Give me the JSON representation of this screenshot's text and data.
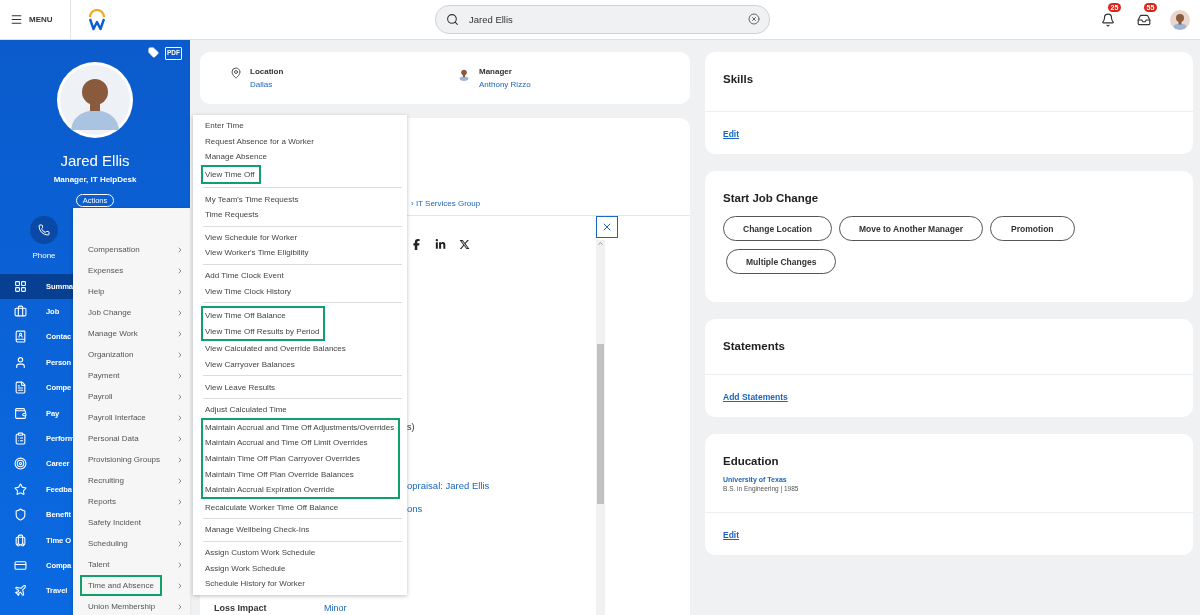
{
  "header": {
    "menu_label": "MENU",
    "search": {
      "value": "Jared Ellis"
    },
    "notifications_badge": "25",
    "inbox_badge": "55"
  },
  "profile": {
    "pdf_label": "PDF",
    "name": "Jared Ellis",
    "title": "Manager, IT HelpDesk",
    "actions_label": "Actions",
    "contact": [
      {
        "label": "Phone"
      }
    ]
  },
  "nav": [
    {
      "label": "Summa",
      "selected": true
    },
    {
      "label": "Job",
      "selected": false
    },
    {
      "label": "Contac",
      "selected": false
    },
    {
      "label": "Person",
      "selected": false
    },
    {
      "label": "Compe",
      "selected": false
    },
    {
      "label": "Pay",
      "selected": false
    },
    {
      "label": "Perform",
      "selected": false
    },
    {
      "label": "Career",
      "selected": false
    },
    {
      "label": "Feedba",
      "selected": false
    },
    {
      "label": "Benefit",
      "selected": false
    },
    {
      "label": "Time O",
      "selected": false
    },
    {
      "label": "Compa",
      "selected": false
    },
    {
      "label": "Travel",
      "selected": false
    }
  ],
  "info_card": {
    "fields": [
      {
        "kind": "location",
        "label": "Location",
        "value": "Dallas"
      },
      {
        "kind": "person",
        "label": "Manager",
        "value": "Anthony Rizzo"
      }
    ]
  },
  "detail_card": {
    "breadcrumb": "› IT Services Group",
    "fragments": [
      {
        "kind": "text",
        "text": "s)"
      },
      {
        "kind": "link",
        "text": "opraisal: Jared Ellis"
      },
      {
        "kind": "link",
        "text": "ons"
      }
    ],
    "rows": [
      {
        "label": "Loss Impact",
        "value": "Minor"
      }
    ]
  },
  "actions_menu": {
    "items": [
      {
        "label": "Compensation",
        "highlighted": false
      },
      {
        "label": "Expenses",
        "highlighted": false
      },
      {
        "label": "Help",
        "highlighted": false
      },
      {
        "label": "Job Change",
        "highlighted": false
      },
      {
        "label": "Manage Work",
        "highlighted": false
      },
      {
        "label": "Organization",
        "highlighted": false
      },
      {
        "label": "Payment",
        "highlighted": false
      },
      {
        "label": "Payroll",
        "highlighted": false
      },
      {
        "label": "Payroll Interface",
        "highlighted": false
      },
      {
        "label": "Personal Data",
        "highlighted": false
      },
      {
        "label": "Provisioning Groups",
        "highlighted": false
      },
      {
        "label": "Recruiting",
        "highlighted": false
      },
      {
        "label": "Reports",
        "highlighted": false
      },
      {
        "label": "Safety Incident",
        "highlighted": false
      },
      {
        "label": "Scheduling",
        "highlighted": false
      },
      {
        "label": "Talent",
        "highlighted": false
      },
      {
        "label": "Time and Absence",
        "highlighted": true
      },
      {
        "label": "Union Membership",
        "highlighted": false
      }
    ]
  },
  "submenu": {
    "groups": [
      {
        "items": [
          {
            "label": "Enter Time",
            "highlighted": false
          },
          {
            "label": "Request Absence for a Worker",
            "highlighted": false
          },
          {
            "label": "Manage Absence",
            "highlighted": false
          },
          {
            "label": "View Time Off",
            "highlighted": true
          }
        ]
      },
      {
        "items": [
          {
            "label": "My Team's Time Requests",
            "highlighted": false
          },
          {
            "label": "Time Requests",
            "highlighted": false
          }
        ]
      },
      {
        "items": [
          {
            "label": "View Schedule for Worker",
            "highlighted": false
          },
          {
            "label": "View Worker's Time Eligibility",
            "highlighted": false
          }
        ]
      },
      {
        "items": [
          {
            "label": "Add Time Clock Event",
            "highlighted": false
          },
          {
            "label": "View Time Clock History",
            "highlighted": false
          }
        ]
      },
      {
        "items": [
          {
            "label": "View Time Off Balance",
            "highlighted": true
          },
          {
            "label": "View Time Off Results by Period",
            "highlighted": true
          },
          {
            "label": "View Calculated and Override Balances",
            "highlighted": false
          },
          {
            "label": "View Carryover Balances",
            "highlighted": false
          }
        ]
      },
      {
        "items": [
          {
            "label": "View Leave Results",
            "highlighted": false
          }
        ]
      },
      {
        "items": [
          {
            "label": "Adjust Calculated Time",
            "highlighted": false
          },
          {
            "label": "Maintain Accrual and Time Off Adjustments/Overrides",
            "highlighted": true
          },
          {
            "label": "Maintain Accrual and Time Off Limit Overrides",
            "highlighted": true
          },
          {
            "label": "Maintain Time Off Plan Carryover Overrides",
            "highlighted": true
          },
          {
            "label": "Maintain Time Off Plan Override Balances",
            "highlighted": true
          },
          {
            "label": "Maintain Accrual Expiration Override",
            "highlighted": true
          },
          {
            "label": "Recalculate Worker Time Off Balance",
            "highlighted": false
          }
        ]
      },
      {
        "items": [
          {
            "label": "Manage Wellbeing Check-Ins",
            "highlighted": false
          }
        ]
      },
      {
        "items": [
          {
            "label": "Assign Custom Work Schedule",
            "highlighted": false
          },
          {
            "label": "Assign Work Schedule",
            "highlighted": false
          },
          {
            "label": "Schedule History for Worker",
            "highlighted": false
          }
        ]
      }
    ]
  },
  "skills": {
    "title": "Skills",
    "link": "Edit"
  },
  "job_change": {
    "title": "Start Job Change",
    "buttons": [
      "Change Location",
      "Move to Another Manager",
      "Promotion",
      "Multiple Changes"
    ]
  },
  "statements": {
    "title": "Statements",
    "link": "Add Statements"
  },
  "education": {
    "title": "Education",
    "school": "University of Texas",
    "degree": "B.S. in Engineering | 1985",
    "link": "Edit"
  }
}
